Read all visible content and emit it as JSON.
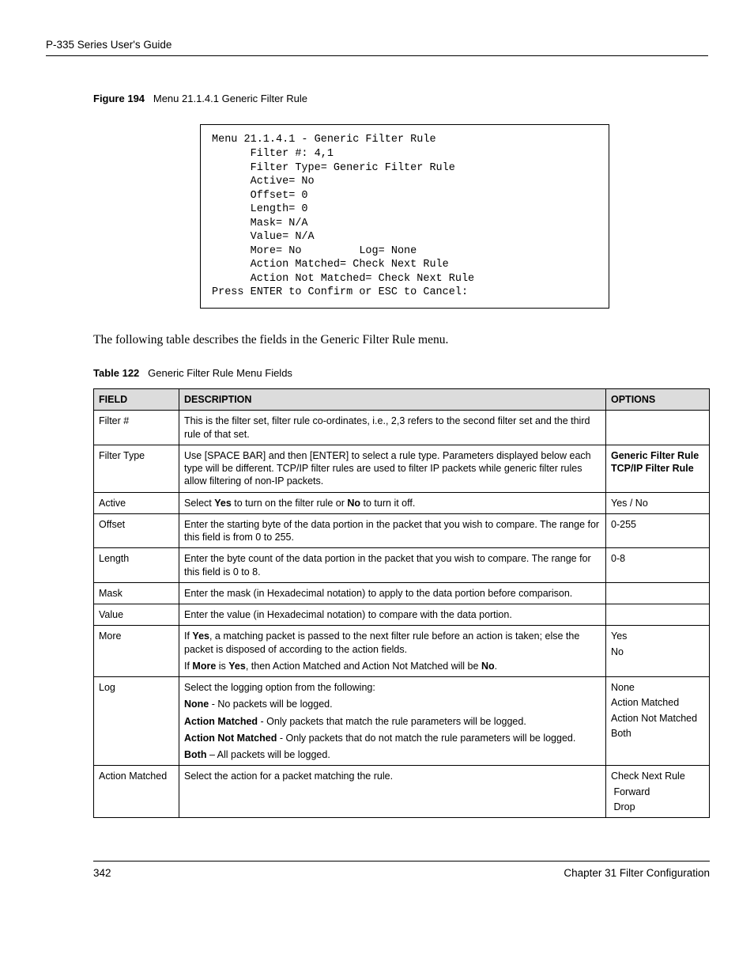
{
  "header": {
    "title": "P-335 Series User's Guide"
  },
  "figure": {
    "label": "Figure 194",
    "caption": "Menu 21.1.4.1 Generic Filter Rule",
    "content": "Menu 21.1.4.1 - Generic Filter Rule\n      Filter #: 4,1\n      Filter Type= Generic Filter Rule\n      Active= No\n      Offset= 0\n      Length= 0\n      Mask= N/A\n      Value= N/A\n      More= No         Log= None\n      Action Matched= Check Next Rule\n      Action Not Matched= Check Next Rule\nPress ENTER to Confirm or ESC to Cancel:"
  },
  "intro": "The following table describes the fields in the Generic Filter Rule menu.",
  "table": {
    "label": "Table 122",
    "caption": "Generic Filter Rule Menu Fields",
    "head": {
      "field": "FIELD",
      "desc": "DESCRIPTION",
      "opts": "OPTIONS"
    },
    "rows": [
      {
        "field": "Filter #",
        "desc_html": "This is the filter set, filter rule co-ordinates, i.e., 2,3 refers to the second filter set and the third rule of that set.",
        "opts_html": ""
      },
      {
        "field": "Filter Type",
        "desc_html": "Use [SPACE BAR] and then [ENTER] to select a rule type. Parameters displayed below each type will be different. TCP/IP filter rules are used to filter IP packets while generic filter rules allow filtering of non-IP packets.",
        "opts_html": "<b>Generic Filter Rule</b><br><b>TCP/IP Filter Rule</b>"
      },
      {
        "field": "Active",
        "desc_html": "Select <b>Yes</b> to turn on the filter rule or <b>No</b> to turn it off.",
        "opts_html": "Yes / No"
      },
      {
        "field": "Offset",
        "desc_html": "Enter the starting byte of the data portion in the packet that you wish to compare. The range for this field is from 0 to 255.",
        "opts_html": "0-255"
      },
      {
        "field": "Length",
        "desc_html": "Enter the byte count of the data portion in the packet that you wish to compare. The range for this field is 0 to 8.",
        "opts_html": "0-8"
      },
      {
        "field": "Mask",
        "desc_html": "Enter the mask (in Hexadecimal notation) to apply to the data portion before comparison.",
        "opts_html": ""
      },
      {
        "field": "Value",
        "desc_html": "Enter the value (in Hexadecimal notation) to compare with the data portion.",
        "opts_html": ""
      },
      {
        "field": "More",
        "desc_html": "<p>If <b>Yes</b>, a matching packet is passed to the next filter rule before an action is taken; else the packet is disposed of according to the action fields.</p><p>If <b>More</b> is <b>Yes</b>, then Action Matched and Action Not Matched will be <b>No</b>.</p>",
        "opts_html": "<span class=\"opts-line\">Yes</span><span class=\"opts-line\">No</span>"
      },
      {
        "field": "Log",
        "desc_html": "<p>Select the logging option from the following:</p><p><b>None</b> - No packets will be logged.</p><p><b>Action Matched</b> - Only packets that match the rule parameters will be logged.</p><p><b>Action Not Matched</b> - Only packets that do not match the rule parameters will be logged.</p><p><b>Both</b> – All packets will be logged.</p>",
        "opts_html": "<span class=\"opts-line\">None</span><span class=\"opts-line\">Action Matched</span><span class=\"opts-line\">Action Not Matched</span><span class=\"opts-line\">Both</span>"
      },
      {
        "field": "Action Matched",
        "desc_html": "Select the action for a packet matching the rule.",
        "opts_html": "<span class=\"opts-line\">Check Next Rule</span><span class=\"opts-line\">&nbsp;Forward</span><span class=\"opts-line\">&nbsp;Drop</span>"
      }
    ]
  },
  "footer": {
    "page": "342",
    "chapter": "Chapter 31 Filter Configuration"
  }
}
